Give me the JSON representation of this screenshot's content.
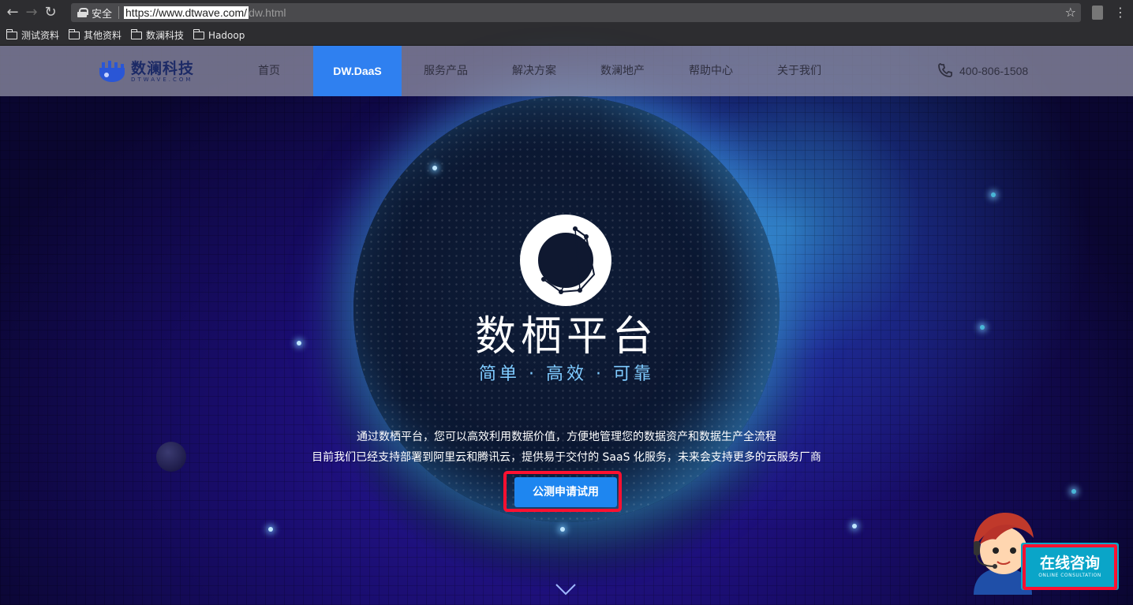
{
  "browser": {
    "secure_label": "安全",
    "url_main": "https://www.dtwave.com/",
    "url_rest": "dw.html"
  },
  "bookmarks": [
    "测试资料",
    "其他资料",
    "数澜科技",
    "Hadoop"
  ],
  "site": {
    "logo_cn": "数澜科技",
    "logo_en": "DTWAVE.COM",
    "nav": [
      "首页",
      "DW.DaaS",
      "服务产品",
      "解决方案",
      "数澜地产",
      "帮助中心",
      "关于我们"
    ],
    "nav_active": "DW.DaaS",
    "phone": "400-806-1508"
  },
  "hero": {
    "title": "数栖平台",
    "subtitle": "简单 · 高效 · 可靠",
    "desc_line1": "通过数栖平台，您可以高效利用数据价值，方便地管理您的数据资产和数据生产全流程",
    "desc_line2": "目前我们已经支持部署到阿里云和腾讯云，提供易于交付的 SaaS 化服务，未来会支持更多的云服务厂商",
    "cta_label": "公测申请试用"
  },
  "consult": {
    "label_cn": "在线咨询",
    "label_en": "ONLINE CONSULTATION"
  },
  "colors": {
    "accent": "#2f80f0",
    "cta": "#1e86f0",
    "highlight": "#ff1030",
    "consult": "#0aa5c8"
  }
}
